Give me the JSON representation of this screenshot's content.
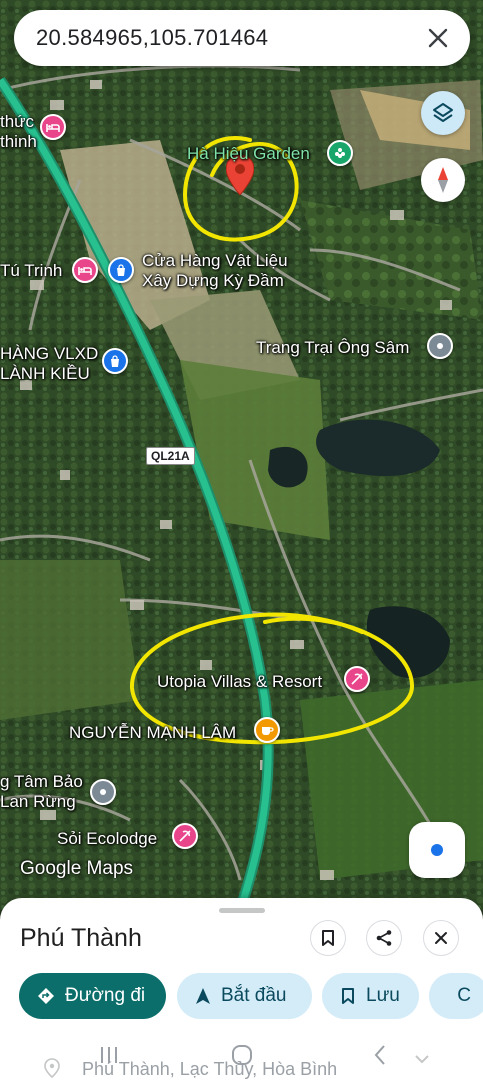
{
  "search": {
    "query": "20.584965,105.701464"
  },
  "map": {
    "road_badge": "QL21A",
    "labels": {
      "thuc_thinh": "thức\nthinh",
      "ha_hieu_garden": "Hà Hiệu Garden",
      "tu_trinh": "Tú Trinh",
      "cua_hang": "Cửa Hàng Vật Liệu\nXây Dựng Kỳ Đầm",
      "hang_vlxd": "HÀNG VLXD\nLÀNH KIỀU",
      "trang_trai": "Trang Trại Ông Sâm",
      "utopia": "Utopia Villas & Resort",
      "nguyen_manh_lam": "NGUYỄN MẠNH LÂM",
      "tam_bao": "g Tâm Bảo\nLan Rừng",
      "soi_ecolodge": "Sỏi Ecolodge"
    },
    "logo": "Google Maps",
    "colors": {
      "highway": "#27c08e",
      "annotation": "#f2e600",
      "pin": "#ea4335",
      "hotel": "#e8458b",
      "shop": "#1a73e8",
      "cafe": "#f29900",
      "park": "#18a66b",
      "generic": "#7c8a95"
    }
  },
  "sheet": {
    "title": "Phú Thành",
    "chips": {
      "directions": "Đường đi",
      "start": "Bắt đầu",
      "save": "Lưu",
      "share": "C"
    },
    "address": "Phú Thành, Lạc Thủy, Hòa Bình"
  }
}
